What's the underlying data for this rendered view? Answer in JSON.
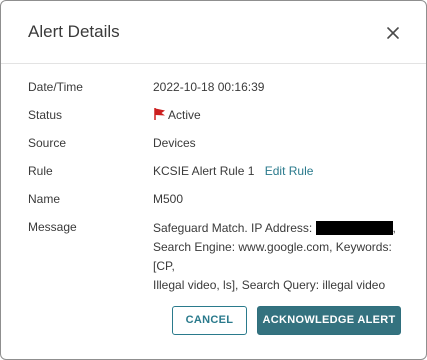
{
  "dialog": {
    "title": "Alert Details",
    "close_icon": "close-icon"
  },
  "fields": {
    "datetime": {
      "label": "Date/Time",
      "value": "2022-10-18 00:16:39"
    },
    "status": {
      "label": "Status",
      "value": "Active",
      "icon": "red-flag-icon",
      "icon_color": "#cc1f1f"
    },
    "source": {
      "label": "Source",
      "value": "Devices"
    },
    "rule": {
      "label": "Rule",
      "value": "KCSIE Alert Rule 1",
      "link": "Edit Rule"
    },
    "name": {
      "label": "Name",
      "value": "M500"
    },
    "message": {
      "label": "Message",
      "prefix": "Safeguard Match. IP Address: ",
      "suffix": ",",
      "line2": "Search Engine: www.google.com, Keywords: [CP,",
      "line3": "Illegal video, ls], Search Query: illegal video"
    }
  },
  "actions": {
    "cancel_label": "CANCEL",
    "acknowledge_label": "ACKNOWLEDGE ALERT"
  },
  "colors": {
    "accent": "#34727f",
    "link": "#2a7a8c",
    "text": "#3a3a3a"
  }
}
